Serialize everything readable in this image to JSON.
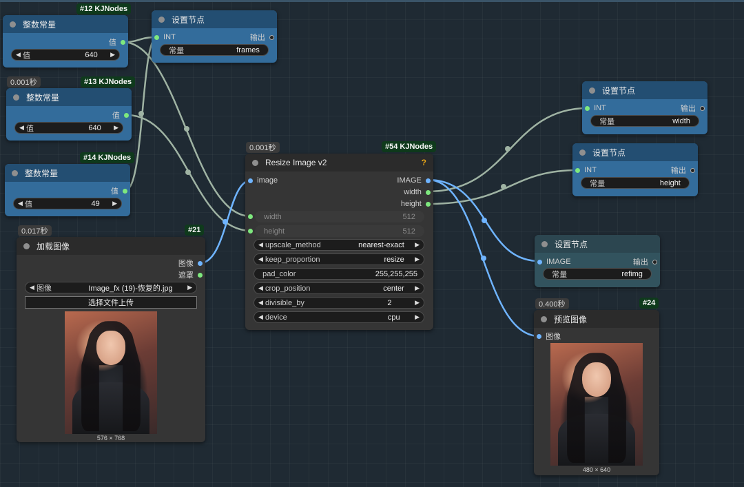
{
  "colors": {
    "link_int": "#9fb3a3",
    "link_image": "#6fb4ff",
    "accent_help": "#e6a417"
  },
  "nodes": {
    "n12": {
      "badge": "#12 KJNodes",
      "title": "整数常量",
      "output": "值",
      "widget": {
        "label": "值",
        "value": "640"
      }
    },
    "n13": {
      "time": "0.001秒",
      "badge": "#13 KJNodes",
      "title": "整数常量",
      "output": "值",
      "widget": {
        "label": "值",
        "value": "640"
      }
    },
    "n14": {
      "badge": "#14 KJNodes",
      "title": "整数常量",
      "output": "值",
      "widget": {
        "label": "值",
        "value": "49"
      }
    },
    "set_frames": {
      "title": "设置节点",
      "input": "INT",
      "output": "输出",
      "widget": {
        "label": "常量",
        "value": "frames"
      }
    },
    "set_width": {
      "title": "设置节点",
      "input": "INT",
      "output": "输出",
      "widget": {
        "label": "常量",
        "value": "width"
      }
    },
    "set_height": {
      "title": "设置节点",
      "input": "INT",
      "output": "输出",
      "widget": {
        "label": "常量",
        "value": "height"
      }
    },
    "set_refimg": {
      "title": "设置节点",
      "input": "IMAGE",
      "output": "输出",
      "widget": {
        "label": "常量",
        "value": "refimg"
      }
    },
    "load": {
      "time": "0.017秒",
      "badge": "#21",
      "title": "加载图像",
      "outputs": [
        "图像",
        "遮罩"
      ],
      "widget": {
        "label": "图像",
        "value": "Image_fx (19)-恢复的.jpg"
      },
      "upload": "选择文件上传",
      "caption": "576 × 768"
    },
    "resize": {
      "time": "0.001秒",
      "badge": "#54 KJNodes",
      "title": "Resize Image v2",
      "help": "?",
      "input": "image",
      "outputs": [
        "IMAGE",
        "width",
        "height"
      ],
      "width": {
        "label": "width",
        "value": "512"
      },
      "height": {
        "label": "height",
        "value": "512"
      },
      "upscale_method": {
        "label": "upscale_method",
        "value": "nearest-exact"
      },
      "keep_proportion": {
        "label": "keep_proportion",
        "value": "resize"
      },
      "pad_color": {
        "label": "pad_color",
        "value": "255,255,255"
      },
      "crop_position": {
        "label": "crop_position",
        "value": "center"
      },
      "divisible_by": {
        "label": "divisible_by",
        "value": "2"
      },
      "device": {
        "label": "device",
        "value": "cpu"
      }
    },
    "preview": {
      "time": "0.400秒",
      "badge": "#24",
      "title": "预览图像",
      "input": "图像",
      "caption": "480 × 640"
    }
  }
}
